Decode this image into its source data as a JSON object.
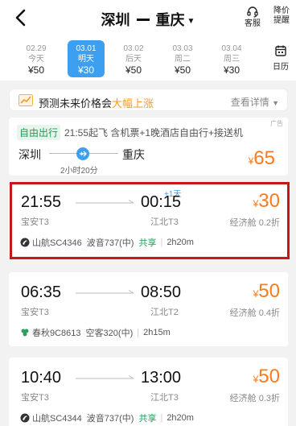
{
  "header": {
    "from_city": "深圳",
    "to_city": "重庆",
    "service_label": "客服",
    "alert_label_1": "降价",
    "alert_label_2": "提醒"
  },
  "dates": [
    {
      "date": "02.29",
      "day": "今天",
      "price": "¥50",
      "active": false
    },
    {
      "date": "03.01",
      "day": "明天",
      "price": "¥30",
      "active": true
    },
    {
      "date": "03.02",
      "day": "后天",
      "price": "¥50",
      "active": false
    },
    {
      "date": "03.03",
      "day": "周二",
      "price": "¥50",
      "active": false
    },
    {
      "date": "03.04",
      "day": "周三",
      "price": "¥30",
      "active": false
    }
  ],
  "calendar_label": "日历",
  "prediction": {
    "text_prefix": "预测未来价格会",
    "text_highlight": "大幅上涨",
    "more_label": "查看详情"
  },
  "package": {
    "ad_label": "广告",
    "tag": "自由出行",
    "info": "21:55起飞  含机票+1晚酒店自由行+接送机",
    "from": "深圳",
    "to": "重庆",
    "duration": "2小时20分",
    "currency": "¥",
    "price": "65"
  },
  "flights": [
    {
      "dep_time": "21:55",
      "arr_time": "00:15",
      "plus_day": "+1天",
      "dep_airport": "宝安T3",
      "arr_airport": "江北T3",
      "currency": "¥",
      "price": "30",
      "cabin": "经济舱 0.2折",
      "airline": "山航SC4346",
      "aircraft": "波音737(中)",
      "share": "共享",
      "duration": "2h20m"
    },
    {
      "dep_time": "06:35",
      "arr_time": "08:50",
      "plus_day": "",
      "dep_airport": "宝安T3",
      "arr_airport": "江北T2",
      "currency": "¥",
      "price": "50",
      "cabin": "经济舱 0.4折",
      "airline": "春秋9C8613",
      "aircraft": "空客320(中)",
      "share": "",
      "duration": "2h15m"
    },
    {
      "dep_time": "10:40",
      "arr_time": "13:00",
      "plus_day": "",
      "dep_airport": "宝安T3",
      "arr_airport": "江北T3",
      "currency": "¥",
      "price": "50",
      "cabin": "经济舱 0.3折",
      "airline": "山航SC4344",
      "aircraft": "波音737(中)",
      "share": "共享",
      "duration": "2h20m"
    }
  ],
  "colors": {
    "accent": "#3d9ff0",
    "price": "#ff7a1a",
    "share": "#18a058",
    "highlight_border": "#c8161d"
  }
}
